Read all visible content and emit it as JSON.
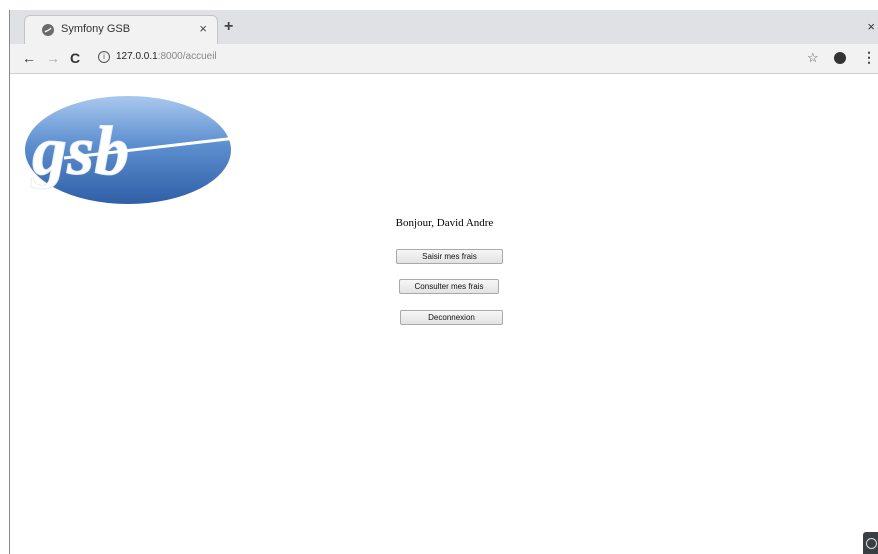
{
  "browser": {
    "tab": {
      "title": "Symfony GSB",
      "close_label": "×"
    },
    "new_tab_label": "+",
    "window_close_label": "×",
    "nav": {
      "back": "←",
      "forward": "→",
      "reload": "C"
    },
    "address": {
      "host": "127.0.0.1",
      "path": ":8000/accueil"
    },
    "icons": [
      "info-icon",
      "star-icon",
      "profile-icon",
      "menu-icon"
    ]
  },
  "page": {
    "logo_text": "gsb",
    "greeting": "Bonjour, David Andre",
    "buttons": {
      "saisir": "Saisir mes frais",
      "consulter": "Consulter mes frais",
      "deconnexion": "Deconnexion"
    }
  },
  "colors": {
    "logo_blue": "#4a7fc1",
    "logo_blue_light": "#9fc0e8"
  }
}
